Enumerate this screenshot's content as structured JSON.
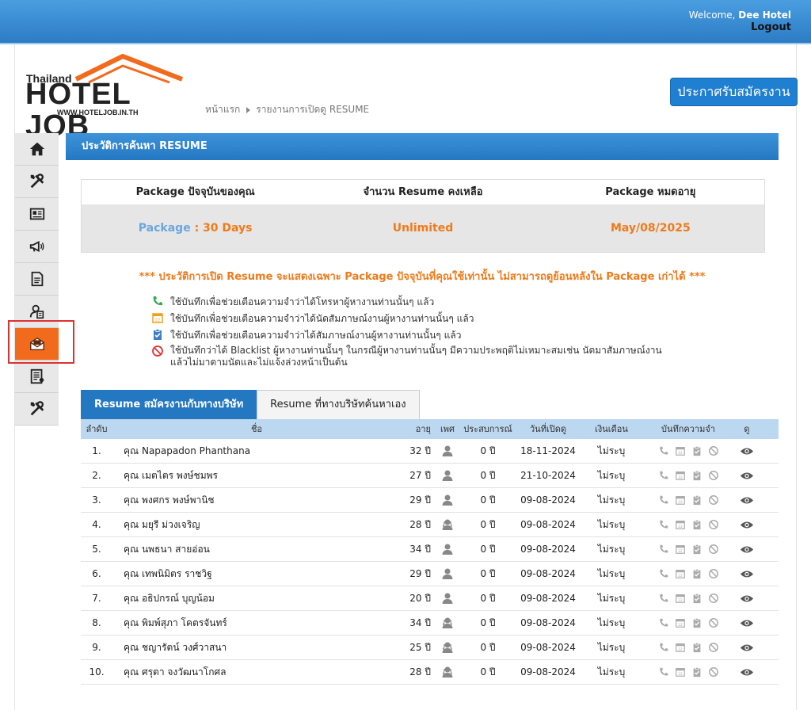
{
  "header": {
    "welcome_prefix": "Welcome, ",
    "user": "Dee Hotel",
    "logout": "Logout"
  },
  "logo": {
    "thailand": "Thailand",
    "hotel_job": "HOTEL JOB",
    "url": "WWW.HOTELJOB.IN.TH"
  },
  "breadcrumb": {
    "home": "หน้าแรก",
    "current": "รายงานการเปิดดู RESUME"
  },
  "post_job_button": "ประกาศรับสมัครงาน",
  "sidebar": [
    {
      "icon": "home-icon"
    },
    {
      "icon": "tools-icon"
    },
    {
      "icon": "newspaper-icon"
    },
    {
      "icon": "megaphone-icon"
    },
    {
      "icon": "document-icon"
    },
    {
      "icon": "user-search-icon"
    },
    {
      "icon": "envelope-icon",
      "active": true
    },
    {
      "icon": "list-icon"
    },
    {
      "icon": "tools-icon"
    }
  ],
  "section_title": "ประวัติการค้นหา RESUME",
  "package": {
    "headers": [
      "Package ปัจจุบันของคุณ",
      "จำนวน Resume คงเหลือ",
      "Package หมดอายุ"
    ],
    "label": "Package",
    "value": " : 30 Days",
    "remaining": "Unlimited",
    "expiry": "May/08/2025"
  },
  "notice": "*** ประวัติการเปิด Resume จะแสดงเฉพาะ Package ปัจจุบันที่คุณใช้เท่านั้น ไม่สามารถดูย้อนหลังใน Package เก่าได้ ***",
  "legend": [
    "ใช้บันทึกเพื่อช่วยเตือนความจำว่าได้โทรหาผู้หางานท่านนั้นๆ แล้ว",
    "ใช้บันทึกเพื่อช่วยเตือนความจำว่าได้นัดสัมภาษณ์งานผู้หางานท่านนั้นๆ แล้ว",
    "ใช้บันทึกเพื่อช่วยเตือนความจำว่าได้สัมภาษณ์งานผู้หางานท่านนั้นๆ แล้ว",
    "ใช้บันทึกว่าได้ Blacklist ผู้หางานท่านนั้นๆ ในกรณีผู้หางานท่านนั้นๆ มีความประพฤติไม่เหมาะสมเช่น นัดมาสัมภาษณ์งาน",
    "แล้วไม่มาตามนัดและไม่แจ้งล่วงหน้าเป็นต้น"
  ],
  "tabs": [
    "Resume สมัครงานกับทางบริษัท",
    "Resume ที่ทางบริษัทค้นหาเอง"
  ],
  "table": {
    "headers": [
      "ลำดับ",
      "ชื่อ",
      "อายุ",
      "เพศ",
      "ประสบการณ์",
      "วันที่เปิดดู",
      "เงินเดือน",
      "บันทึกความจำ",
      "ดู"
    ],
    "rows": [
      {
        "no": "1.",
        "name": "คุณ Napapadon Phanthana",
        "age": "32 ปี",
        "gender": "male",
        "exp": "0 ปี",
        "date": "18-11-2024",
        "salary": "ไม่ระบุ"
      },
      {
        "no": "2.",
        "name": "คุณ เมตไตร พงษ์ชมพร",
        "age": "27 ปี",
        "gender": "male",
        "exp": "0 ปี",
        "date": "21-10-2024",
        "salary": "ไม่ระบุ"
      },
      {
        "no": "3.",
        "name": "คุณ พงศกร พงษ์พานิช",
        "age": "29 ปี",
        "gender": "male",
        "exp": "0 ปี",
        "date": "09-08-2024",
        "salary": "ไม่ระบุ"
      },
      {
        "no": "4.",
        "name": "คุณ มยุรี ม่วงเจริญ",
        "age": "28 ปี",
        "gender": "female",
        "exp": "0 ปี",
        "date": "09-08-2024",
        "salary": "ไม่ระบุ"
      },
      {
        "no": "5.",
        "name": "คุณ นพธนา สายอ่อน",
        "age": "34 ปี",
        "gender": "male",
        "exp": "0 ปี",
        "date": "09-08-2024",
        "salary": "ไม่ระบุ"
      },
      {
        "no": "6.",
        "name": "คุณ เทพนิมิตร ราชวิฐ",
        "age": "29 ปี",
        "gender": "male",
        "exp": "0 ปี",
        "date": "09-08-2024",
        "salary": "ไม่ระบุ"
      },
      {
        "no": "7.",
        "name": "คุณ อธิปกรณ์ บุญน้อม",
        "age": "20 ปี",
        "gender": "male",
        "exp": "0 ปี",
        "date": "09-08-2024",
        "salary": "ไม่ระบุ"
      },
      {
        "no": "8.",
        "name": "คุณ พิมพ์สุภา โคตรจันทร์",
        "age": "34 ปี",
        "gender": "female",
        "exp": "0 ปี",
        "date": "09-08-2024",
        "salary": "ไม่ระบุ"
      },
      {
        "no": "9.",
        "name": "คุณ ชญารัตน์ วงศ์วาสนา",
        "age": "25 ปี",
        "gender": "female",
        "exp": "0 ปี",
        "date": "09-08-2024",
        "salary": "ไม่ระบุ"
      },
      {
        "no": "10.",
        "name": "คุณ ศรุตา จงวัฒนาโกศล",
        "age": "28 ปี",
        "gender": "female",
        "exp": "0 ปี",
        "date": "09-08-2024",
        "salary": "ไม่ระบุ"
      }
    ]
  },
  "colors": {
    "accent_blue": "#2478c2",
    "accent_orange": "#f26b1d",
    "notice_orange": "#f07a1a"
  }
}
